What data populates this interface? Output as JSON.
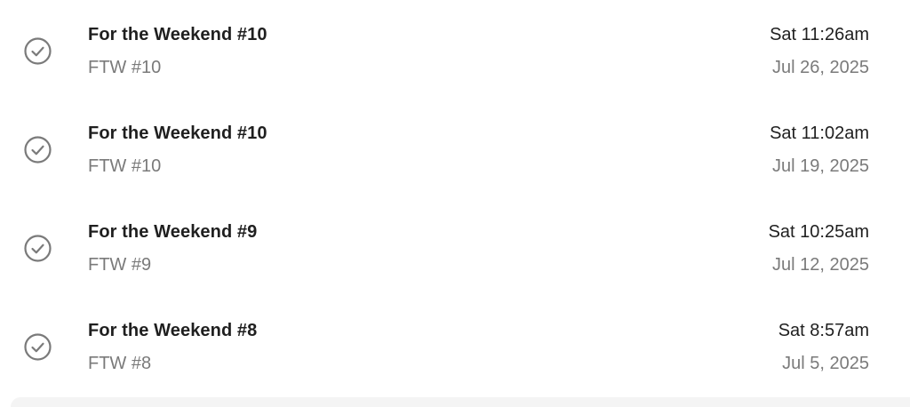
{
  "items": [
    {
      "icon": "check-circle-icon",
      "title": "For the Weekend #10",
      "subtitle": "FTW #10",
      "time": "Sat 11:26am",
      "date": "Jul 26, 2025"
    },
    {
      "icon": "check-circle-icon",
      "title": "For the Weekend #10",
      "subtitle": "FTW #10",
      "time": "Sat 11:02am",
      "date": "Jul 19, 2025"
    },
    {
      "icon": "check-circle-icon",
      "title": "For the Weekend #9",
      "subtitle": "FTW #9",
      "time": "Sat 10:25am",
      "date": "Jul 12, 2025"
    },
    {
      "icon": "check-circle-icon",
      "title": "For the Weekend #8",
      "subtitle": "FTW #8",
      "time": "Sat 8:57am",
      "date": "Jul 5, 2025"
    }
  ],
  "colors": {
    "title": "#1f1f1f",
    "secondary": "#7a7a7a",
    "icon": "#7a7a7a"
  }
}
